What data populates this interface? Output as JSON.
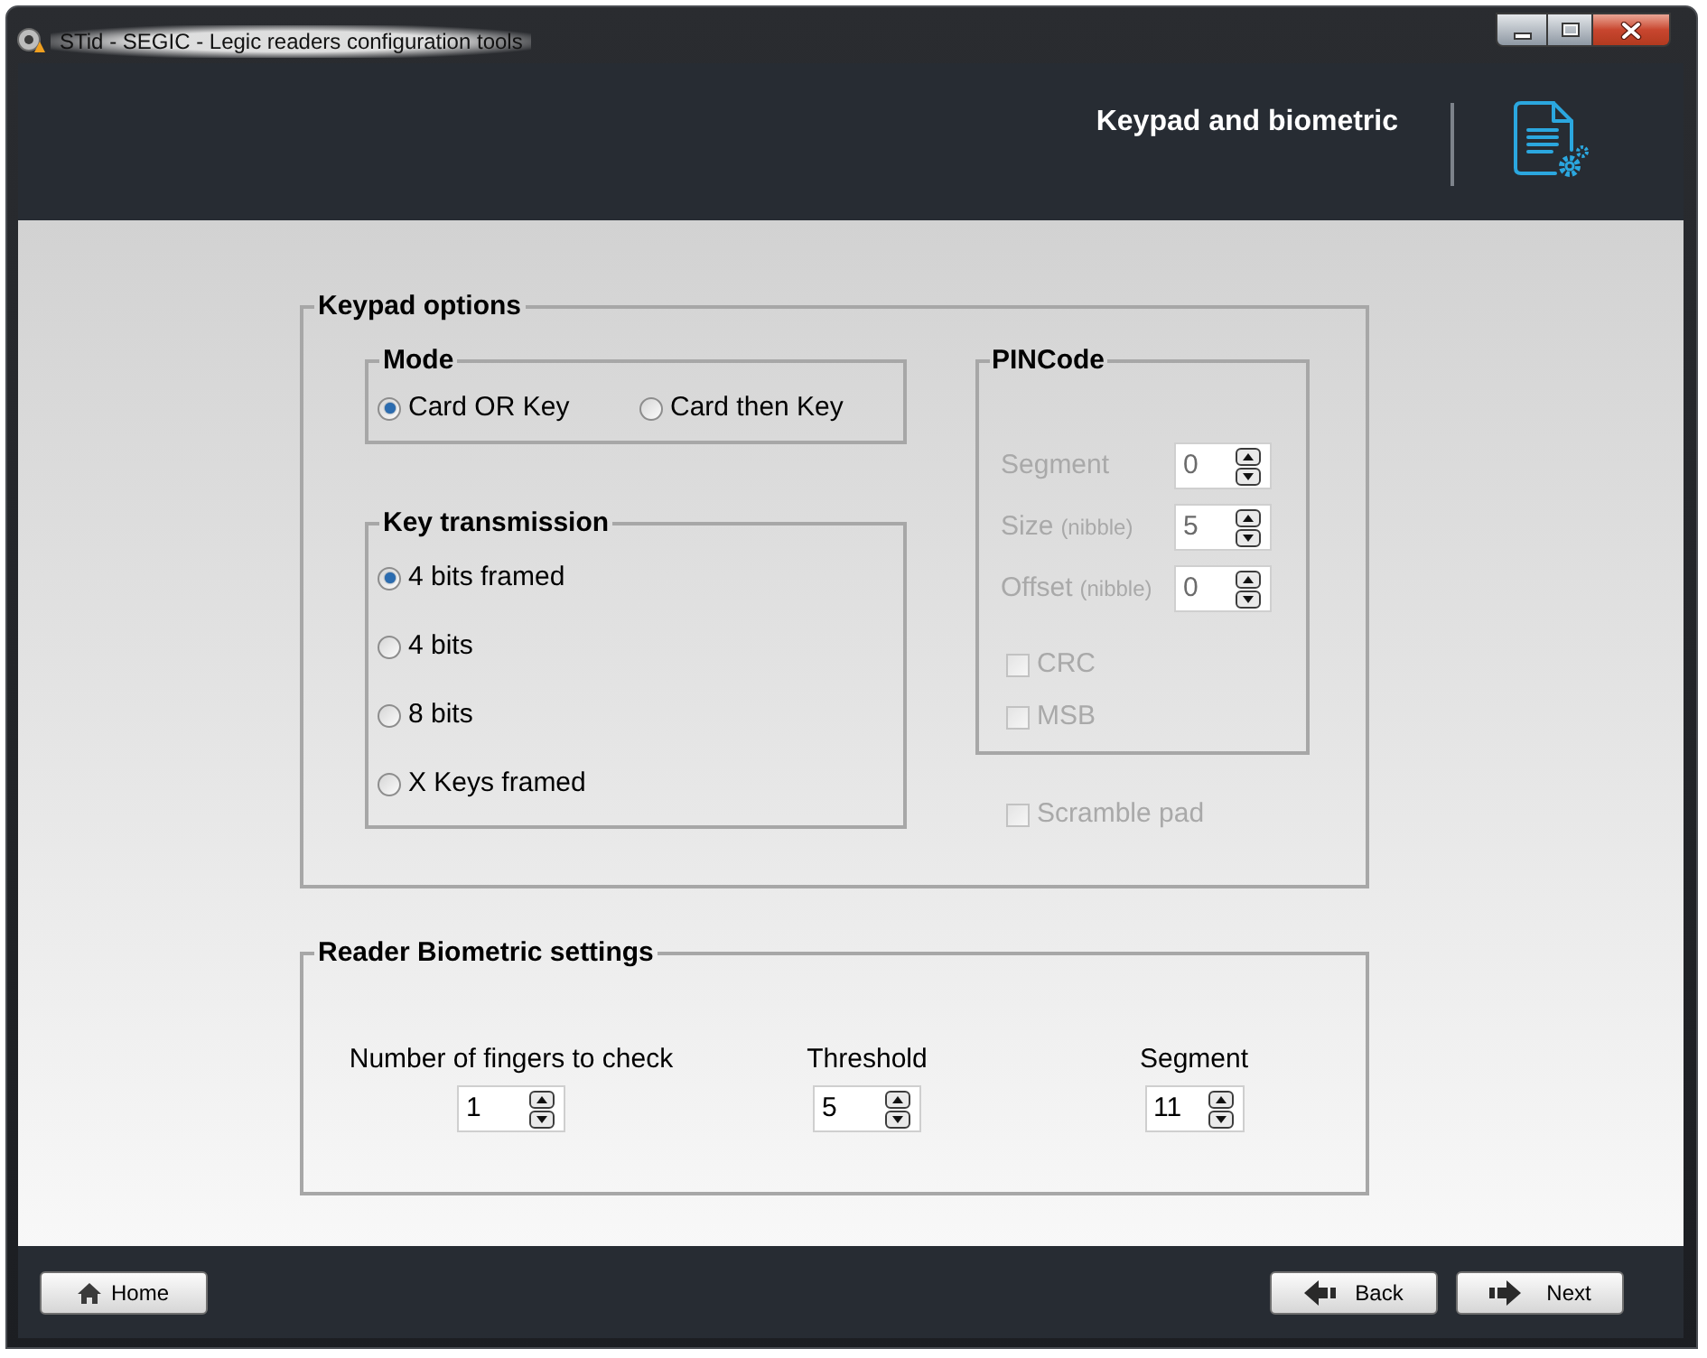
{
  "window": {
    "title": "STid - SEGIC - Legic readers configuration tools"
  },
  "header": {
    "title": "Keypad and biometric"
  },
  "keypad_options": {
    "legend": "Keypad options",
    "mode": {
      "legend": "Mode",
      "options": [
        {
          "label": "Card OR Key",
          "selected": true
        },
        {
          "label": "Card then Key",
          "selected": false
        }
      ]
    },
    "key_transmission": {
      "legend": "Key transmission",
      "options": [
        {
          "label": "4 bits framed",
          "selected": true
        },
        {
          "label": "4 bits",
          "selected": false
        },
        {
          "label": "8 bits",
          "selected": false
        },
        {
          "label": "X Keys framed",
          "selected": false
        }
      ]
    },
    "pincode": {
      "legend": "PINCode",
      "disabled": true,
      "fields": [
        {
          "label": "Segment",
          "value": "0"
        },
        {
          "label": "Size",
          "unit": "(nibble)",
          "value": "5"
        },
        {
          "label": "Offset",
          "unit": "(nibble)",
          "value": "0"
        }
      ],
      "checkboxes": [
        {
          "label": "CRC",
          "checked": false
        },
        {
          "label": "MSB",
          "checked": false
        }
      ]
    },
    "scramble_pad": {
      "label": "Scramble pad",
      "checked": false,
      "disabled": true
    }
  },
  "biometric_settings": {
    "legend": "Reader Biometric settings",
    "fields": [
      {
        "label": "Number of fingers to check",
        "value": "1"
      },
      {
        "label": "Threshold",
        "value": "5"
      },
      {
        "label": "Segment",
        "value": "11"
      }
    ]
  },
  "footer": {
    "buttons": [
      {
        "kind": "home",
        "label": "Home"
      },
      {
        "kind": "back",
        "label": "Back"
      },
      {
        "kind": "next",
        "label": "Next"
      }
    ]
  }
}
